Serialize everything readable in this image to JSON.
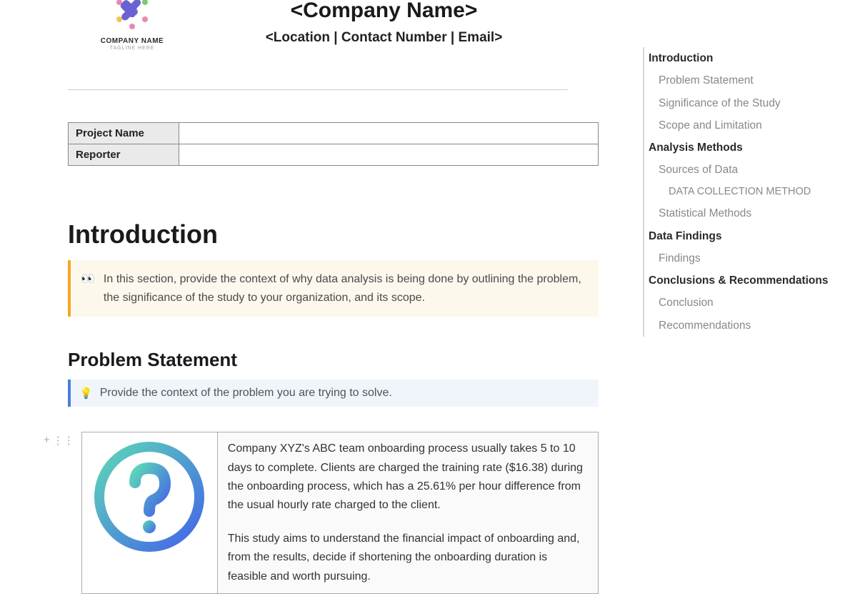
{
  "header": {
    "logo_label": "COMPANY NAME",
    "logo_tagline": "TAGLINE HERE",
    "title": "<Company Name>",
    "subtitle": "<Location | Contact Number | Email>"
  },
  "meta": {
    "rows": [
      {
        "label": "Project Name",
        "value": ""
      },
      {
        "label": "Reporter",
        "value": ""
      }
    ]
  },
  "sections": {
    "introduction": {
      "title": "Introduction",
      "callout_icon": "👀",
      "callout_text": "In this section, provide the context of why data analysis is being done by outlining the problem, the significance of the study to your organization, and its scope."
    },
    "problem_statement": {
      "title": "Problem Statement",
      "callout_icon": "💡",
      "callout_text": "Provide the context of the problem you are trying to solve.",
      "body_p1": "Company XYZ's ABC team onboarding process usually takes 5 to 10 days to complete. Clients are charged the training rate ($16.38) during the onboarding process, which has a 25.61% per hour difference from the usual hourly rate charged to the client.",
      "body_p2": "This study aims to understand the financial impact of onboarding and, from the results, decide if shortening the onboarding duration is feasible and worth pursuing."
    }
  },
  "outline": [
    {
      "label": "Introduction",
      "level": 1
    },
    {
      "label": "Problem Statement",
      "level": 2
    },
    {
      "label": "Significance of the Study",
      "level": 2
    },
    {
      "label": "Scope and Limitation",
      "level": 2
    },
    {
      "label": "Analysis Methods",
      "level": 1
    },
    {
      "label": "Sources of Data",
      "level": 2
    },
    {
      "label": "DATA COLLECTION METHOD",
      "level": 3
    },
    {
      "label": "Statistical Methods",
      "level": 2
    },
    {
      "label": "Data Findings",
      "level": 1
    },
    {
      "label": "Findings",
      "level": 2
    },
    {
      "label": "Conclusions & Recommendations",
      "level": 1
    },
    {
      "label": "Conclusion",
      "level": 2
    },
    {
      "label": "Recommendations",
      "level": 2
    }
  ],
  "controls": {
    "add": "+",
    "drag": "⋮⋮"
  }
}
